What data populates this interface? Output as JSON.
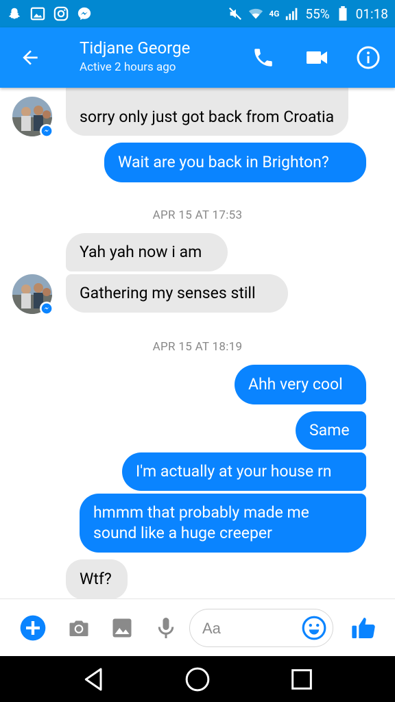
{
  "status_bar": {
    "battery": "55%",
    "time": "01:18",
    "network_label": "4G",
    "icons": [
      "snapchat-icon",
      "gallery-icon",
      "instagram-icon",
      "messenger-icon",
      "mute-icon",
      "wifi-icon",
      "signal-icon",
      "battery-icon"
    ]
  },
  "header": {
    "title": "Tidjane George",
    "subtitle": "Active 2 hours ago",
    "icons": [
      "back-arrow-icon",
      "phone-icon",
      "video-camera-icon",
      "info-icon"
    ],
    "background": "#1190ff"
  },
  "messages": {
    "m1": "sorry only just got back from Croatia",
    "m2": "Wait are you back in Brighton?",
    "stamp1": "APR 15 AT 17:53",
    "m3": "Yah yah now i am",
    "m4": "Gathering my senses still",
    "stamp2": "APR 15 AT 18:19",
    "m5": "Ahh very cool",
    "m6": "Same",
    "m7": "I'm actually at your house rn",
    "m8": "hmmm that probably made me sound like a huge creeper",
    "m9": "Wtf?"
  },
  "composer": {
    "placeholder": "Aa",
    "icons": [
      "plus-icon",
      "camera-icon",
      "image-icon",
      "microphone-icon",
      "emoji-icon",
      "thumbs-up-icon"
    ]
  },
  "navbar": {
    "icons": [
      "back-nav-icon",
      "home-nav-icon",
      "recents-nav-icon"
    ]
  },
  "colors": {
    "accent": "#0a84ff",
    "incoming_bubble": "#e8e8e8",
    "status_bar": "#0288d1"
  }
}
